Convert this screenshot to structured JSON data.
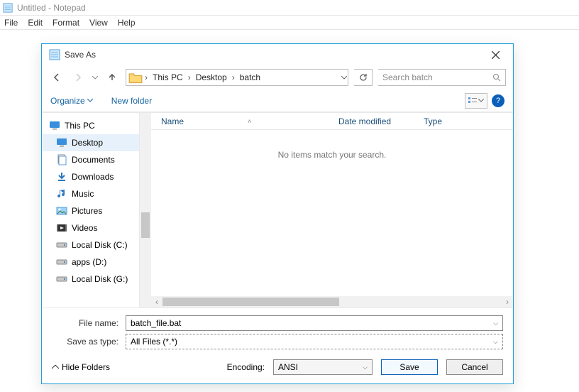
{
  "notepad": {
    "title": "Untitled - Notepad",
    "menu": {
      "file": "File",
      "edit": "Edit",
      "format": "Format",
      "view": "View",
      "help": "Help"
    }
  },
  "dialog": {
    "title": "Save As",
    "breadcrumb": {
      "root": "This PC",
      "mid": "Desktop",
      "leaf": "batch"
    },
    "search_placeholder": "Search batch",
    "toolbar": {
      "organize": "Organize",
      "newfolder": "New folder"
    },
    "help_glyph": "?",
    "tree": {
      "thispc": "This PC",
      "desktop": "Desktop",
      "documents": "Documents",
      "downloads": "Downloads",
      "music": "Music",
      "pictures": "Pictures",
      "videos": "Videos",
      "localc": "Local Disk (C:)",
      "appsd": "apps (D:)",
      "localg": "Local Disk (G:)"
    },
    "columns": {
      "name": "Name",
      "date": "Date modified",
      "type": "Type"
    },
    "empty": "No items match your search.",
    "labels": {
      "filename": "File name:",
      "saveas": "Save as type:",
      "encoding": "Encoding:"
    },
    "values": {
      "filename": "batch_file.bat",
      "saveas": "All Files  (*.*)",
      "encoding": "ANSI"
    },
    "buttons": {
      "hide": "Hide Folders",
      "save": "Save",
      "cancel": "Cancel"
    }
  }
}
